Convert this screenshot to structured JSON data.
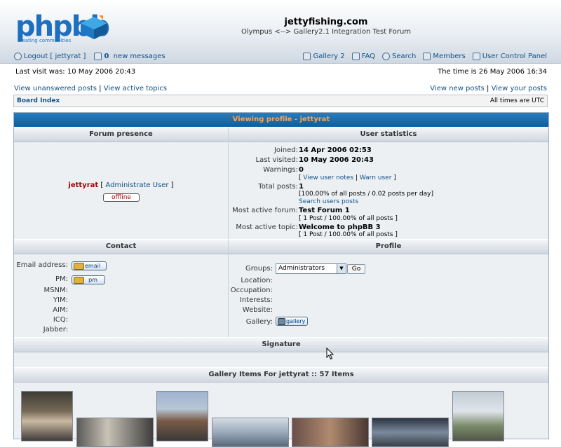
{
  "header": {
    "logo_word": "phpbb",
    "logo_tag": "creating communities",
    "site_title": "jettyfishing.com",
    "site_desc": "Olympus <--> Gallery2.1 Integration Test Forum"
  },
  "nav": {
    "logout": "Logout [ jettyrat ]",
    "messages_count": "0",
    "messages_text": " new messages",
    "gallery": "Gallery 2",
    "faq": "FAQ",
    "search": "Search",
    "members": "Members",
    "ucp": "User Control Panel"
  },
  "status": {
    "last_visit": "Last visit was: 10 May 2006 20:43",
    "time_now": "The time is 26 May 2006 16:34"
  },
  "quicklinks": {
    "unanswered": "View unanswered posts",
    "active": "View active topics",
    "new_posts": "View new posts",
    "your_posts": "View your posts",
    "sep": " | "
  },
  "breadcrumb": {
    "board_index": "Board Index",
    "timezone": "All times are UTC"
  },
  "profile": {
    "caption": "Viewing profile - jettyrat",
    "forum_presence": "Forum presence",
    "user_statistics": "User statistics",
    "username": "jettyrat",
    "admin_open": " [ ",
    "admin_link": "Administrate User",
    "admin_close": " ]",
    "online_status": "offline",
    "stats": {
      "joined_label": "Joined:",
      "joined": "14 Apr 2006 02:53",
      "last_visited_label": "Last visited:",
      "last_visited": "10 May 2006 20:43",
      "warnings_label": "Warnings:",
      "warnings": "0",
      "view_notes": "View user notes",
      "warn_user": "Warn user",
      "total_posts_label": "Total posts:",
      "total_posts": "1",
      "posts_detail": "[100.00% of all posts / 0.02 posts per day]",
      "search_posts": "Search users posts",
      "active_forum_label": "Most active forum:",
      "active_forum": "Test Forum 1",
      "active_forum_detail": "[ 1 Post / 100.00% of all posts ]",
      "active_topic_label": "Most active topic:",
      "active_topic": "Welcome to phpBB 3",
      "active_topic_detail": "[ 1 Post / 100.00% of all posts ]"
    },
    "contact_header": "Contact",
    "profile_header": "Profile",
    "contact": {
      "email_label": "Email address:",
      "email_btn": "email",
      "pm_label": "PM:",
      "pm_btn": "pm",
      "msnm_label": "MSNM:",
      "yim_label": "YIM:",
      "aim_label": "AIM:",
      "icq_label": "ICQ:",
      "jabber_label": "Jabber:"
    },
    "profile_fields": {
      "groups_label": "Groups:",
      "groups_selected": "Administrators",
      "go": "Go",
      "location_label": "Location:",
      "occupation_label": "Occupation:",
      "interests_label": "Interests:",
      "website_label": "Website:",
      "gallery_label": "Gallery:",
      "gallery_btn": "gallery"
    },
    "signature_header": "Signature",
    "gallery_items_header": "Gallery Items For jettyrat :: 57 Items"
  },
  "colors": {
    "caption_bg": "#0a5fa0",
    "caption_text": "#ffa34f",
    "link": "#105289",
    "username": "#aa0000",
    "row_bg": "#ecf0f3"
  }
}
